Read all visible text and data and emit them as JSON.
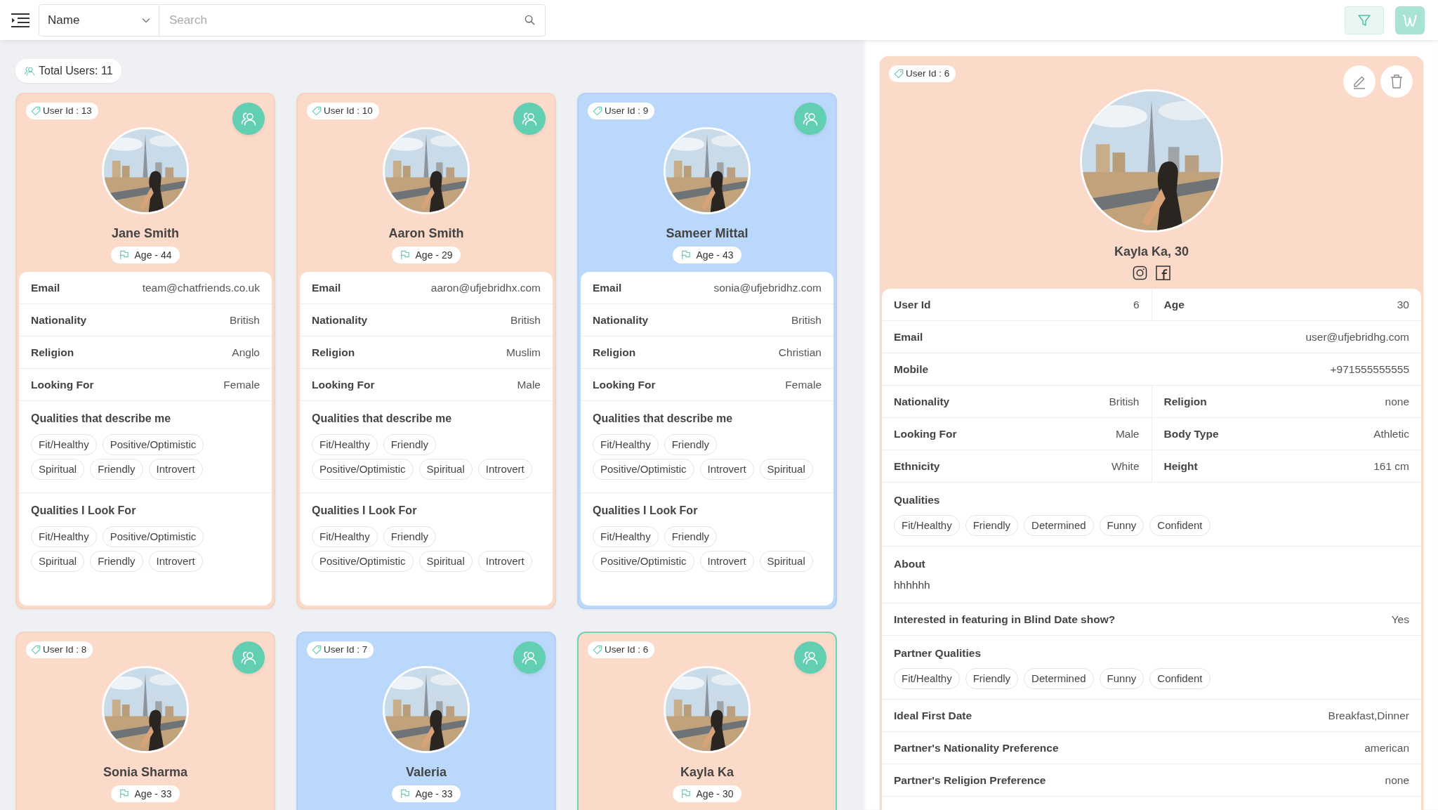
{
  "toolbar": {
    "sort_select": {
      "value": "Name"
    },
    "search": {
      "placeholder": "Search"
    }
  },
  "total_users": "Total Users: 11",
  "cards": [
    {
      "user_id": "User Id : 13",
      "name": "Jane Smith",
      "age": "Age - 44",
      "color": "#fcdac9",
      "selected": false,
      "details": [
        {
          "label": "Email",
          "value": "team@chatfriends.co.uk"
        },
        {
          "label": "Nationality",
          "value": "British"
        },
        {
          "label": "Religion",
          "value": "Anglo"
        },
        {
          "label": "Looking For",
          "value": "Female"
        }
      ],
      "sections": [
        {
          "title": "Qualities that describe me",
          "tags": [
            "Fit/Healthy",
            "Positive/Optimistic",
            "Spiritual",
            "Friendly",
            "Introvert"
          ]
        },
        {
          "title": "Qualities I Look For",
          "tags": [
            "Fit/Healthy",
            "Positive/Optimistic",
            "Spiritual",
            "Friendly",
            "Introvert"
          ]
        }
      ]
    },
    {
      "user_id": "User Id : 10",
      "name": "Aaron Smith",
      "age": "Age - 29",
      "color": "#fcdac9",
      "selected": false,
      "details": [
        {
          "label": "Email",
          "value": "aaron@ufjebridhx.com"
        },
        {
          "label": "Nationality",
          "value": "British"
        },
        {
          "label": "Religion",
          "value": "Muslim"
        },
        {
          "label": "Looking For",
          "value": "Male"
        }
      ],
      "sections": [
        {
          "title": "Qualities that describe me",
          "tags": [
            "Fit/Healthy",
            "Friendly",
            "Positive/Optimistic",
            "Spiritual",
            "Introvert"
          ]
        },
        {
          "title": "Qualities I Look For",
          "tags": [
            "Fit/Healthy",
            "Friendly",
            "Positive/Optimistic",
            "Spiritual",
            "Introvert"
          ]
        }
      ]
    },
    {
      "user_id": "User Id : 9",
      "name": "Sameer Mittal",
      "age": "Age - 43",
      "color": "#b9d8fb",
      "selected": false,
      "details": [
        {
          "label": "Email",
          "value": "sonia@ufjebridhz.com"
        },
        {
          "label": "Nationality",
          "value": "British"
        },
        {
          "label": "Religion",
          "value": "Christian"
        },
        {
          "label": "Looking For",
          "value": "Female"
        }
      ],
      "sections": [
        {
          "title": "Qualities that describe me",
          "tags": [
            "Fit/Healthy",
            "Friendly",
            "Positive/Optimistic",
            "Introvert",
            "Spiritual"
          ]
        },
        {
          "title": "Qualities I Look For",
          "tags": [
            "Fit/Healthy",
            "Friendly",
            "Positive/Optimistic",
            "Introvert",
            "Spiritual"
          ]
        }
      ]
    },
    {
      "user_id": "User Id : 8",
      "name": "Sonia Sharma",
      "age": "Age - 33",
      "color": "#fcdac9",
      "selected": false
    },
    {
      "user_id": "User Id : 7",
      "name": "Valeria",
      "age": "Age - 33",
      "color": "#b9d8fb",
      "selected": false
    },
    {
      "user_id": "User Id : 6",
      "name": "Kayla Ka",
      "age": "Age - 30",
      "color": "#fcdac9",
      "selected": true
    }
  ],
  "profile": {
    "user_id": "User Id : 6",
    "name": "Kayla Ka, 30",
    "rows": [
      {
        "kind": "pair",
        "cells": [
          {
            "label": "User Id",
            "value": "6"
          },
          {
            "label": "Age",
            "value": "30"
          }
        ]
      },
      {
        "kind": "single",
        "label": "Email",
        "value": "user@ufjebridhg.com"
      },
      {
        "kind": "single",
        "label": "Mobile",
        "value": "+971555555555"
      },
      {
        "kind": "pair",
        "cells": [
          {
            "label": "Nationality",
            "value": "British"
          },
          {
            "label": "Religion",
            "value": "none"
          }
        ]
      },
      {
        "kind": "pair",
        "cells": [
          {
            "label": "Looking For",
            "value": "Male"
          },
          {
            "label": "Body Type",
            "value": "Athletic"
          }
        ]
      },
      {
        "kind": "pair",
        "cells": [
          {
            "label": "Ethnicity",
            "value": "White"
          },
          {
            "label": "Height",
            "value": "161 cm"
          }
        ]
      },
      {
        "kind": "tags",
        "label": "Qualities",
        "tags": [
          "Fit/Healthy",
          "Friendly",
          "Determined",
          "Funny",
          "Confident"
        ]
      },
      {
        "kind": "text",
        "label": "About",
        "value": "hhhhhh"
      },
      {
        "kind": "single",
        "label": "Interested in featuring in Blind Date show?",
        "value": "Yes"
      },
      {
        "kind": "tags",
        "label": "Partner Qualities",
        "tags": [
          "Fit/Healthy",
          "Friendly",
          "Determined",
          "Funny",
          "Confident"
        ]
      },
      {
        "kind": "single",
        "label": "Ideal First Date",
        "value": "Breakfast,Dinner"
      },
      {
        "kind": "single",
        "label": "Partner's Nationality Preference",
        "value": "american"
      },
      {
        "kind": "single",
        "label": "Partner's Religion Preference",
        "value": "none"
      }
    ]
  }
}
